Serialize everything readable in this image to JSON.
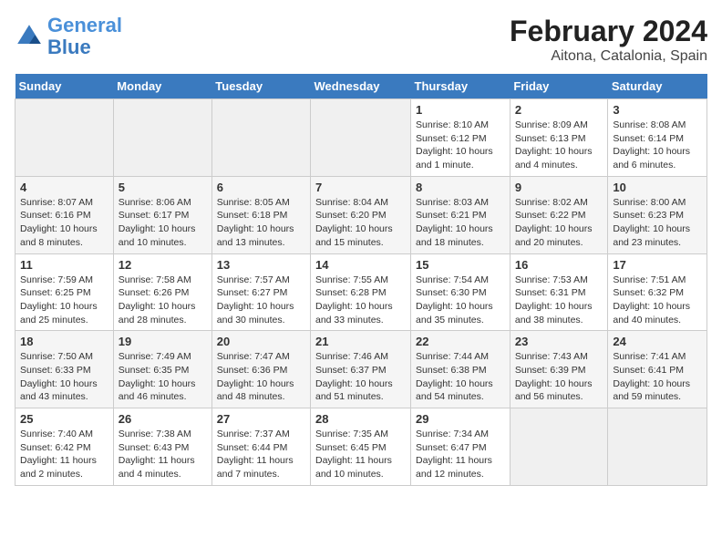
{
  "header": {
    "logo_line1": "General",
    "logo_line2": "Blue",
    "title": "February 2024",
    "subtitle": "Aitona, Catalonia, Spain"
  },
  "weekdays": [
    "Sunday",
    "Monday",
    "Tuesday",
    "Wednesday",
    "Thursday",
    "Friday",
    "Saturday"
  ],
  "weeks": [
    [
      {
        "day": "",
        "info": ""
      },
      {
        "day": "",
        "info": ""
      },
      {
        "day": "",
        "info": ""
      },
      {
        "day": "",
        "info": ""
      },
      {
        "day": "1",
        "info": "Sunrise: 8:10 AM\nSunset: 6:12 PM\nDaylight: 10 hours and 1 minute."
      },
      {
        "day": "2",
        "info": "Sunrise: 8:09 AM\nSunset: 6:13 PM\nDaylight: 10 hours and 4 minutes."
      },
      {
        "day": "3",
        "info": "Sunrise: 8:08 AM\nSunset: 6:14 PM\nDaylight: 10 hours and 6 minutes."
      }
    ],
    [
      {
        "day": "4",
        "info": "Sunrise: 8:07 AM\nSunset: 6:16 PM\nDaylight: 10 hours and 8 minutes."
      },
      {
        "day": "5",
        "info": "Sunrise: 8:06 AM\nSunset: 6:17 PM\nDaylight: 10 hours and 10 minutes."
      },
      {
        "day": "6",
        "info": "Sunrise: 8:05 AM\nSunset: 6:18 PM\nDaylight: 10 hours and 13 minutes."
      },
      {
        "day": "7",
        "info": "Sunrise: 8:04 AM\nSunset: 6:20 PM\nDaylight: 10 hours and 15 minutes."
      },
      {
        "day": "8",
        "info": "Sunrise: 8:03 AM\nSunset: 6:21 PM\nDaylight: 10 hours and 18 minutes."
      },
      {
        "day": "9",
        "info": "Sunrise: 8:02 AM\nSunset: 6:22 PM\nDaylight: 10 hours and 20 minutes."
      },
      {
        "day": "10",
        "info": "Sunrise: 8:00 AM\nSunset: 6:23 PM\nDaylight: 10 hours and 23 minutes."
      }
    ],
    [
      {
        "day": "11",
        "info": "Sunrise: 7:59 AM\nSunset: 6:25 PM\nDaylight: 10 hours and 25 minutes."
      },
      {
        "day": "12",
        "info": "Sunrise: 7:58 AM\nSunset: 6:26 PM\nDaylight: 10 hours and 28 minutes."
      },
      {
        "day": "13",
        "info": "Sunrise: 7:57 AM\nSunset: 6:27 PM\nDaylight: 10 hours and 30 minutes."
      },
      {
        "day": "14",
        "info": "Sunrise: 7:55 AM\nSunset: 6:28 PM\nDaylight: 10 hours and 33 minutes."
      },
      {
        "day": "15",
        "info": "Sunrise: 7:54 AM\nSunset: 6:30 PM\nDaylight: 10 hours and 35 minutes."
      },
      {
        "day": "16",
        "info": "Sunrise: 7:53 AM\nSunset: 6:31 PM\nDaylight: 10 hours and 38 minutes."
      },
      {
        "day": "17",
        "info": "Sunrise: 7:51 AM\nSunset: 6:32 PM\nDaylight: 10 hours and 40 minutes."
      }
    ],
    [
      {
        "day": "18",
        "info": "Sunrise: 7:50 AM\nSunset: 6:33 PM\nDaylight: 10 hours and 43 minutes."
      },
      {
        "day": "19",
        "info": "Sunrise: 7:49 AM\nSunset: 6:35 PM\nDaylight: 10 hours and 46 minutes."
      },
      {
        "day": "20",
        "info": "Sunrise: 7:47 AM\nSunset: 6:36 PM\nDaylight: 10 hours and 48 minutes."
      },
      {
        "day": "21",
        "info": "Sunrise: 7:46 AM\nSunset: 6:37 PM\nDaylight: 10 hours and 51 minutes."
      },
      {
        "day": "22",
        "info": "Sunrise: 7:44 AM\nSunset: 6:38 PM\nDaylight: 10 hours and 54 minutes."
      },
      {
        "day": "23",
        "info": "Sunrise: 7:43 AM\nSunset: 6:39 PM\nDaylight: 10 hours and 56 minutes."
      },
      {
        "day": "24",
        "info": "Sunrise: 7:41 AM\nSunset: 6:41 PM\nDaylight: 10 hours and 59 minutes."
      }
    ],
    [
      {
        "day": "25",
        "info": "Sunrise: 7:40 AM\nSunset: 6:42 PM\nDaylight: 11 hours and 2 minutes."
      },
      {
        "day": "26",
        "info": "Sunrise: 7:38 AM\nSunset: 6:43 PM\nDaylight: 11 hours and 4 minutes."
      },
      {
        "day": "27",
        "info": "Sunrise: 7:37 AM\nSunset: 6:44 PM\nDaylight: 11 hours and 7 minutes."
      },
      {
        "day": "28",
        "info": "Sunrise: 7:35 AM\nSunset: 6:45 PM\nDaylight: 11 hours and 10 minutes."
      },
      {
        "day": "29",
        "info": "Sunrise: 7:34 AM\nSunset: 6:47 PM\nDaylight: 11 hours and 12 minutes."
      },
      {
        "day": "",
        "info": ""
      },
      {
        "day": "",
        "info": ""
      }
    ]
  ]
}
